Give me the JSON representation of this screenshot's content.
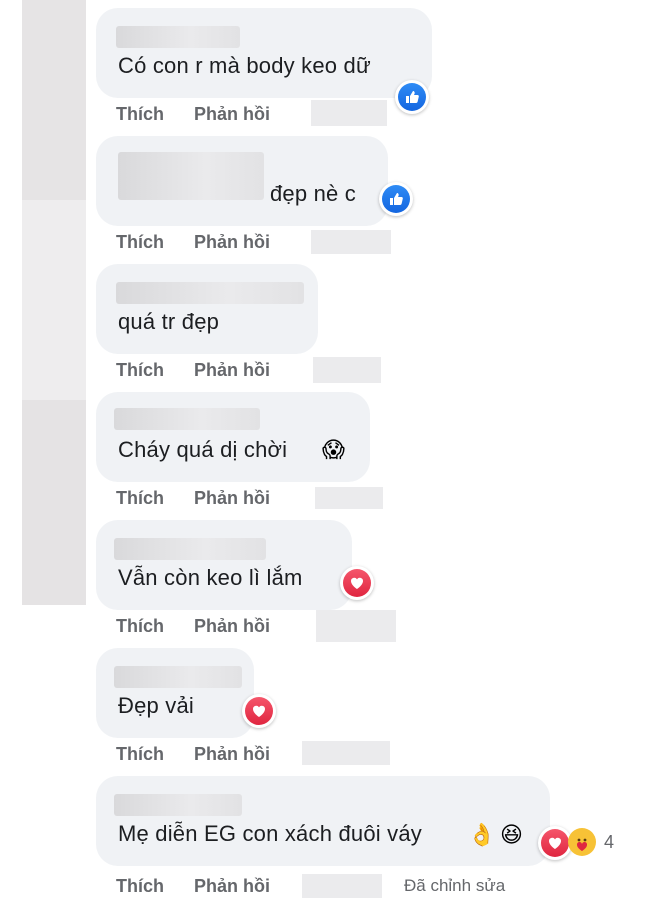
{
  "actions": {
    "like_label": "Thích",
    "reply_label": "Phản hồi"
  },
  "comments": [
    {
      "text": "Có con r mà body keo dữ",
      "reaction": "like-icon"
    },
    {
      "text": "đẹp nè c",
      "reaction": "like-icon"
    },
    {
      "text": "quá tr đẹp",
      "reaction": ""
    },
    {
      "text": "Cháy quá dị chời",
      "emoji": "😱",
      "reaction": ""
    },
    {
      "text": "Vẫn còn keo lì lắm",
      "reaction": "love-icon"
    },
    {
      "text": "Đẹp vải",
      "reaction": "love-icon"
    },
    {
      "text": "Mẹ diễn EG con xách đuôi váy",
      "emoji1": "👌",
      "emoji2": "😆",
      "reaction": "love-icon",
      "reaction_count": "4",
      "edited_label": "Đã chỉnh sửa"
    }
  ],
  "colors": {
    "bubble": "#f0f2f5",
    "text": "#1c1e21",
    "meta": "#65676b",
    "like": "#1877f2",
    "love": "#e02640"
  }
}
